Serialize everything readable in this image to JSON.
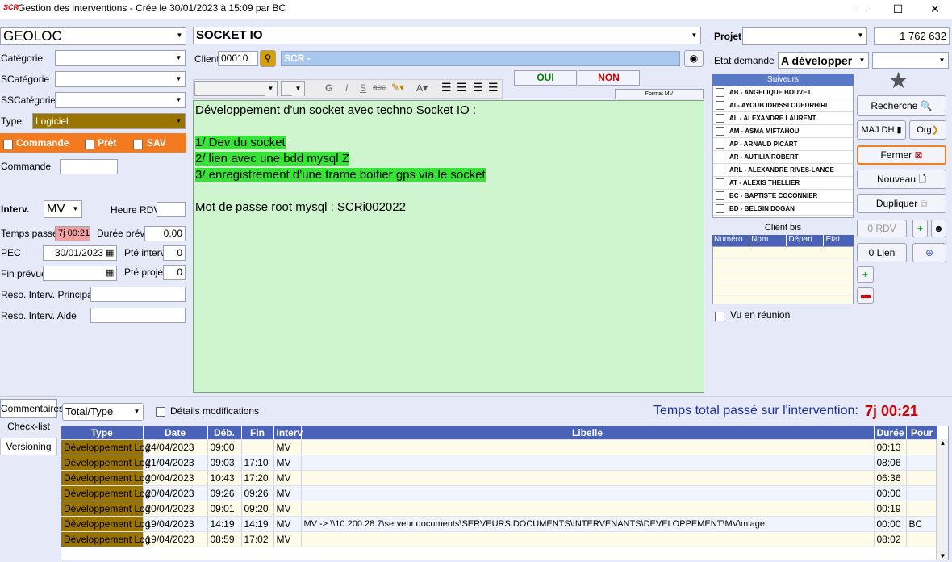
{
  "window": {
    "title": "Gestion des interventions - Crée le 30/01/2023 à 15:09 par BC",
    "app_icon_text": "SCR"
  },
  "left": {
    "client_name": "GEOLOC",
    "categorie_label": "Catégorie",
    "scategorie_label": "SCatégorie",
    "sscategorie_label": "SSCatégorie",
    "type_label": "Type",
    "type_value": "Logiciel",
    "commande_chk": "Commande",
    "pret_chk": "Prêt",
    "sav_chk": "SAV",
    "commande_label": "Commande",
    "interv_label": "Interv.",
    "interv_value": "MV",
    "heure_rdv_label": "Heure RDV",
    "temps_passe_label": "Temps passé",
    "temps_passe_value": "7j 00:21",
    "duree_prev_label": "Durée prév.",
    "duree_prev_value": "0,00",
    "pec_label": "PEC",
    "pec_value": "30/01/2023",
    "pte_interv_label": "Pté interv",
    "pte_interv_value": "0",
    "fin_prevue_label": "Fin prévue",
    "pte_projet_label": "Pté projet",
    "pte_projet_value": "0",
    "reso_principal_label": "Reso. Interv. Principal",
    "reso_aide_label": "Reso. Interv. Aide"
  },
  "center": {
    "subject": "SOCKET IO",
    "client_label": "Client",
    "client_code": "00010",
    "client_name": "SCR -",
    "oui_label": "OUI",
    "non_label": "NON",
    "format_label": "Format MV",
    "editor_lines": [
      {
        "text": "Développement d'un socket avec techno Socket IO :",
        "hl": false
      },
      {
        "text": "",
        "hl": false
      },
      {
        "text": "1/ Dev du socket",
        "hl": true
      },
      {
        "text": "2/ lien avec une bdd mysql Z",
        "hl": true
      },
      {
        "text": "3/ enregistrement d'une trame boitier gps via le socket",
        "hl": true
      },
      {
        "text": "",
        "hl": false
      },
      {
        "text": "Mot de passe root mysql : SCRi002022",
        "hl": false
      }
    ]
  },
  "right": {
    "projet_label": "Projet",
    "projet_number": "1 762 632",
    "etat_label": "Etat demande",
    "etat_value": "A développer",
    "suiveurs_title": "Suiveurs",
    "suiveurs": [
      "AB - ANGELIQUE BOUVET",
      "AI - AYOUB IDRISSI OUEDRHIRI",
      "AL - ALEXANDRE LAURENT",
      "AM - ASMA MIFTAHOU",
      "AP - ARNAUD PICART",
      "AR - AUTILIA ROBERT",
      "ARL - ALEXANDRE RIVES-LANGE",
      "AT - ALEXIS THELLIER",
      "BC - BAPTISTE COCONNIER",
      "BD - BELGIN DOGAN"
    ],
    "client_bis_title": "Client bis",
    "client_bis_cols": [
      "Numéro",
      "Nom",
      "Départ",
      "Etat"
    ],
    "vu_reunion": "Vu en réunion",
    "btn_recherche": "Recherche",
    "btn_majdh": "MAJ DH",
    "btn_org": "Org",
    "btn_fermer": "Fermer",
    "btn_nouveau": "Nouveau",
    "btn_dupliquer": "Dupliquer",
    "btn_rdv": "0 RDV",
    "btn_lien": "0 Lien"
  },
  "bottom": {
    "tabs": [
      "Commentaires",
      "Check-list",
      "Versioning"
    ],
    "total_type": "Total/Type",
    "details_label": "Détails modifications",
    "total_label": "Temps total passé sur l'intervention:",
    "total_value": "7j 00:21",
    "columns": [
      "Type",
      "Date",
      "Déb.",
      "Fin",
      "Interv",
      "Libelle",
      "Durée",
      "Pour"
    ],
    "rows": [
      {
        "type": "Développement Log",
        "date": "24/04/2023",
        "deb": "09:00",
        "fin": "",
        "interv": "MV",
        "libelle": "",
        "duree": "00:13",
        "pour": ""
      },
      {
        "type": "Développement Log",
        "date": "21/04/2023",
        "deb": "09:03",
        "fin": "17:10",
        "interv": "MV",
        "libelle": "",
        "duree": "08:06",
        "pour": ""
      },
      {
        "type": "Développement Log",
        "date": "20/04/2023",
        "deb": "10:43",
        "fin": "17:20",
        "interv": "MV",
        "libelle": "",
        "duree": "06:36",
        "pour": ""
      },
      {
        "type": "Développement Log",
        "date": "20/04/2023",
        "deb": "09:26",
        "fin": "09:26",
        "interv": "MV",
        "libelle": "",
        "duree": "00:00",
        "pour": ""
      },
      {
        "type": "Développement Log",
        "date": "20/04/2023",
        "deb": "09:01",
        "fin": "09:20",
        "interv": "MV",
        "libelle": "",
        "duree": "00:19",
        "pour": ""
      },
      {
        "type": "Développement Log",
        "date": "19/04/2023",
        "deb": "14:19",
        "fin": "14:19",
        "interv": "MV",
        "libelle": "MV -> \\\\10.200.28.7\\serveur.documents\\SERVEURS.DOCUMENTS\\INTERVENANTS\\DEVELOPPEMENT\\MV\\miage",
        "duree": "00:00",
        "pour": "BC"
      },
      {
        "type": "Développement Log",
        "date": "19/04/2023",
        "deb": "08:59",
        "fin": "17:02",
        "interv": "MV",
        "libelle": "",
        "duree": "08:02",
        "pour": ""
      }
    ]
  },
  "colors": {
    "accent_orange": "#f47a20",
    "type_fill": "#9a7400",
    "editor_bg": "#cff5cf",
    "highlight": "#34e534",
    "header_blue": "#4a63b8",
    "total_red": "#d00000"
  }
}
